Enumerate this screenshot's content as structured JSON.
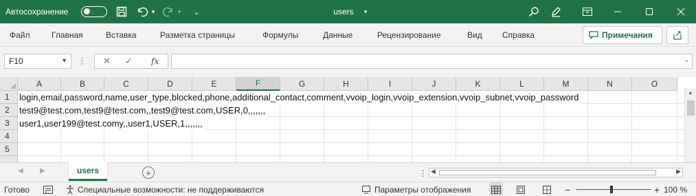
{
  "titlebar": {
    "autosave_label": "Автосохранение",
    "doc_title": "users",
    "bg_color": "#217346"
  },
  "ribbon": {
    "tabs": [
      "Файл",
      "Главная",
      "Вставка",
      "Разметка страницы",
      "Формулы",
      "Данные",
      "Рецензирование",
      "Вид",
      "Справка"
    ],
    "notes_label": "Примечания"
  },
  "formula_bar": {
    "cell_ref": "F10",
    "fx_label": "fx",
    "value": ""
  },
  "sheet": {
    "columns": [
      "A",
      "B",
      "C",
      "D",
      "E",
      "F",
      "G",
      "H",
      "I",
      "J",
      "K",
      "L",
      "M",
      "N",
      "O"
    ],
    "active_column": "F",
    "rows": [
      "1",
      "2",
      "3",
      "4",
      "5"
    ],
    "row_text": [
      "login,email,password,name,user_type,blocked,phone,additional_contact,comment,vvoip_login,vvoip_extension,vvoip_subnet,vvoip_password",
      "test9@test.com,test9@test.com,,test9@test.com,USER,0,,,,,,,",
      "user1,user199@test.comy,,user1,USER,1,,,,,,,"
    ],
    "tab_name": "users"
  },
  "status": {
    "ready": "Готово",
    "accessibility": "Специальные возможности: не поддерживаются",
    "display_settings": "Параметры отображения",
    "zoom_minus": "−",
    "zoom_plus": "+",
    "zoom": "100 %"
  }
}
